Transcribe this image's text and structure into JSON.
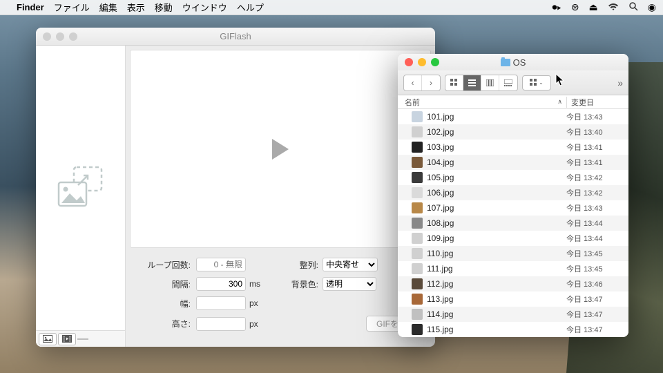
{
  "menubar": {
    "app": "Finder",
    "items": [
      "ファイル",
      "編集",
      "表示",
      "移動",
      "ウインドウ",
      "ヘルプ"
    ]
  },
  "gifWindow": {
    "title": "GIFlash",
    "labels": {
      "loop": "ループ回数:",
      "interval": "間隔:",
      "width": "幅:",
      "height": "高さ:",
      "align": "整列:",
      "bg": "背景色:"
    },
    "placeholders": {
      "loop": "0 - 無限"
    },
    "values": {
      "interval": "300",
      "width": "",
      "height": ""
    },
    "units": {
      "ms": "ms",
      "px": "px"
    },
    "options": {
      "align": "中央寄せ",
      "bg": "透明"
    },
    "export": "GIFを出力"
  },
  "finderWindow": {
    "title": "OS",
    "columns": {
      "name": "名前",
      "date": "変更日"
    },
    "files": [
      {
        "name": "101.jpg",
        "date": "今日 13:43",
        "ic": "#c8d4e0"
      },
      {
        "name": "102.jpg",
        "date": "今日 13:40",
        "ic": "#d0d0d0"
      },
      {
        "name": "103.jpg",
        "date": "今日 13:41",
        "ic": "#222"
      },
      {
        "name": "104.jpg",
        "date": "今日 13:41",
        "ic": "#7a5a3a"
      },
      {
        "name": "105.jpg",
        "date": "今日 13:42",
        "ic": "#3a3a3a"
      },
      {
        "name": "106.jpg",
        "date": "今日 13:42",
        "ic": "#dadada"
      },
      {
        "name": "107.jpg",
        "date": "今日 13:43",
        "ic": "#b88848"
      },
      {
        "name": "108.jpg",
        "date": "今日 13:44",
        "ic": "#888"
      },
      {
        "name": "109.jpg",
        "date": "今日 13:44",
        "ic": "#d0d0d0"
      },
      {
        "name": "110.jpg",
        "date": "今日 13:45",
        "ic": "#d0d0d0"
      },
      {
        "name": "111.jpg",
        "date": "今日 13:45",
        "ic": "#d0d0d0"
      },
      {
        "name": "112.jpg",
        "date": "今日 13:46",
        "ic": "#5a4a3a"
      },
      {
        "name": "113.jpg",
        "date": "今日 13:47",
        "ic": "#a86838"
      },
      {
        "name": "114.jpg",
        "date": "今日 13:47",
        "ic": "#c0c0c0"
      },
      {
        "name": "115.jpg",
        "date": "今日 13:47",
        "ic": "#2a2a2a"
      }
    ]
  }
}
